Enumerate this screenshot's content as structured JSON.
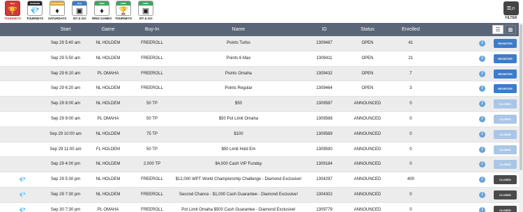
{
  "categories": [
    {
      "band": "NLH",
      "band_color": "#d03a3a",
      "glyph": "🏆",
      "label": "TOURNEYS",
      "active": true
    },
    {
      "band": "DIAMOND",
      "band_color": "#222222",
      "glyph": "💎",
      "label": "TOURNEYS",
      "active": false
    },
    {
      "band": "GUARANTEE",
      "band_color": "#e0a040",
      "glyph": "♦",
      "label": "SATURDAYS",
      "active": false
    },
    {
      "band": "NLH",
      "band_color": "#3d7cc9",
      "glyph": "▣",
      "label": "SIT & GO",
      "active": false
    },
    {
      "band": "FREE",
      "band_color": "#3aa860",
      "glyph": "♦",
      "label": "RING GAMES",
      "active": false
    },
    {
      "band": "FREE",
      "band_color": "#3aa860",
      "glyph": "🏆",
      "label": "TOURNEYS",
      "active": false
    },
    {
      "band": "FREE",
      "band_color": "#3aa860",
      "glyph": "▣",
      "label": "SIT & GO",
      "active": false
    }
  ],
  "filter": {
    "label": "FILTER",
    "icon": "filter-search-icon"
  },
  "columns": {
    "start": "Start",
    "game": "Game",
    "buyin": "Buy-In",
    "name": "Name",
    "id": "ID",
    "status": "Status",
    "enrolled": "Enrolled"
  },
  "rows": [
    {
      "diamond": false,
      "start": "Sep 29 5:40 am",
      "game": "NL HOLDEM",
      "buyin": "FREEROLL",
      "name": "Points Turbo",
      "id": "1309487",
      "status": "OPEN",
      "enrolled": "41",
      "action": "REGISTER",
      "action_style": "register"
    },
    {
      "diamond": false,
      "start": "Sep 29 5:50 am",
      "game": "NL HOLDEM",
      "buyin": "FREEROLL",
      "name": "Points 6 Max",
      "id": "1309411",
      "status": "OPEN",
      "enrolled": "21",
      "action": "REGISTER",
      "action_style": "register"
    },
    {
      "diamond": false,
      "start": "Sep 29 6:10 am",
      "game": "PL OMAHA",
      "buyin": "FREEROLL",
      "name": "Points Omaha",
      "id": "1309432",
      "status": "OPEN",
      "enrolled": "7",
      "action": "REGISTER",
      "action_style": "register"
    },
    {
      "diamond": false,
      "start": "Sep 29 6:20 am",
      "game": "NL HOLDEM",
      "buyin": "FREEROLL",
      "name": "Points Regular",
      "id": "1309464",
      "status": "OPEN",
      "enrolled": "3",
      "action": "REGISTER",
      "action_style": "register"
    },
    {
      "diamond": false,
      "start": "Sep 29 8:00 am",
      "game": "NL HOLDEM",
      "buyin": "50 TP",
      "name": "$50",
      "id": "1309587",
      "status": "ANNOUNCED",
      "enrolled": "0",
      "action": "CLOSED",
      "action_style": "closedlight"
    },
    {
      "diamond": false,
      "start": "Sep 29 9:00 am",
      "game": "PL OMAHA",
      "buyin": "50 TP",
      "name": "$50 Pot Limit Omaha",
      "id": "1309588",
      "status": "ANNOUNCED",
      "enrolled": "0",
      "action": "CLOSED",
      "action_style": "closedlight"
    },
    {
      "diamond": false,
      "start": "Sep 29 10:00 am",
      "game": "NL HOLDEM",
      "buyin": "75 TP",
      "name": "$100",
      "id": "1309589",
      "status": "ANNOUNCED",
      "enrolled": "0",
      "action": "CLOSED",
      "action_style": "closedlight"
    },
    {
      "diamond": false,
      "start": "Sep 29 11:00 am",
      "game": "FL HOLDEM",
      "buyin": "50 TP",
      "name": "$50 Limit Hold Em",
      "id": "1309590",
      "status": "ANNOUNCED",
      "enrolled": "0",
      "action": "CLOSED",
      "action_style": "closedlight"
    },
    {
      "diamond": false,
      "start": "Sep 29 4:00 pm",
      "game": "NL HOLDEM",
      "buyin": "2,000 TP",
      "name": "$4,000 Cash VIP Funday",
      "id": "1309184",
      "status": "ANNOUNCED",
      "enrolled": "0",
      "action": "CLOSED",
      "action_style": "closedlight"
    },
    {
      "diamond": true,
      "start": "Sep 29 5:30 pm",
      "game": "NL HOLDEM",
      "buyin": "FREEROLL",
      "name": "$12,000 WPT World Championship Challenge - Diamond Exclusive!",
      "id": "1304297",
      "status": "ANNOUNCED",
      "enrolled": "400",
      "action": "CLOSED",
      "action_style": "closeddark"
    },
    {
      "diamond": true,
      "start": "Sep 29 7:30 pm",
      "game": "NL HOLDEM",
      "buyin": "FREEROLL",
      "name": "Second Chance - $1,000 Cash Guarantee - Diamond Exclusive!",
      "id": "1304302",
      "status": "ANNOUNCED",
      "enrolled": "0",
      "action": "CLOSED",
      "action_style": "closeddark"
    },
    {
      "diamond": true,
      "start": "Sep 30 7:30 pm",
      "game": "PL OMAHA",
      "buyin": "FREEROLL",
      "name": "Pot Limit Omaha $500 Cash Guarantee - Diamond Exclusive!",
      "id": "1309779",
      "status": "ANNOUNCED",
      "enrolled": "0",
      "action": "CLOSED",
      "action_style": "closeddark"
    }
  ]
}
